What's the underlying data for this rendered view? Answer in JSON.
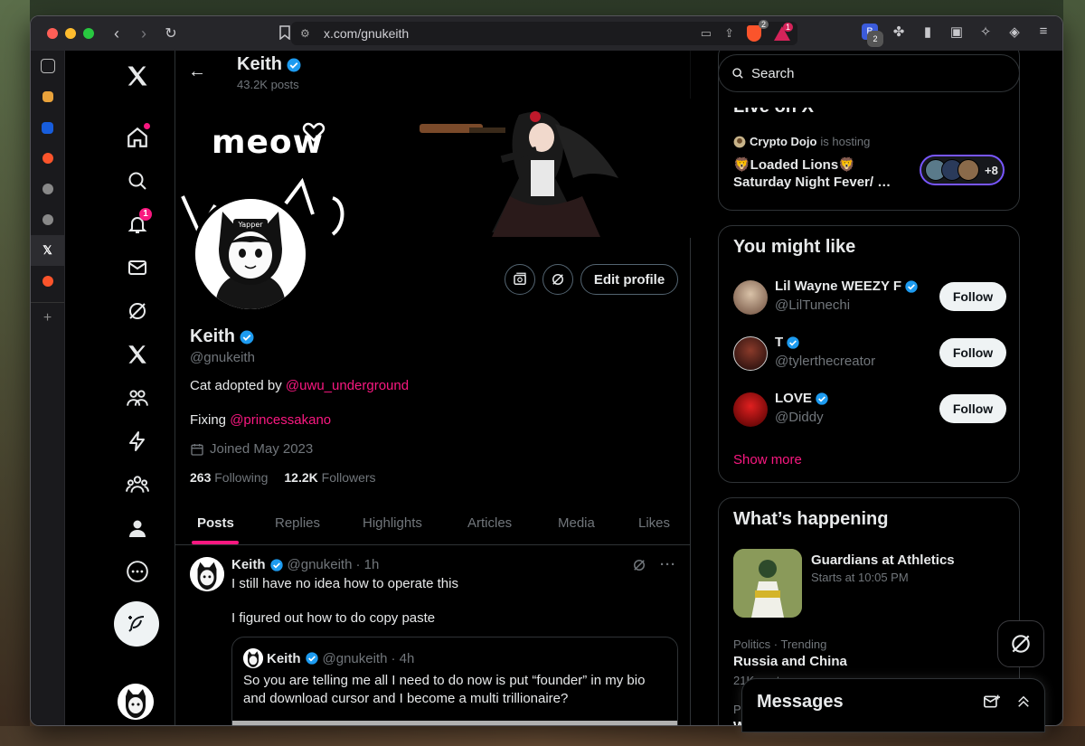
{
  "browser": {
    "url": "x.com/gnukeith",
    "brave_badge": "2",
    "rewards_badge": "1",
    "wallet_badge": "2"
  },
  "nav": {
    "notifications_badge": "1"
  },
  "header": {
    "name": "Keith",
    "posts": "43.2K posts"
  },
  "banner": {
    "meow_text": "meow",
    "yapper_text": "Yapper"
  },
  "profile": {
    "edit_label": "Edit profile",
    "name": "Keith",
    "handle": "@gnukeith",
    "bio_line1_prefix": "Cat adopted by ",
    "bio_line1_link": "@uwu_underground",
    "bio_line2_prefix": "Fixing ",
    "bio_line2_link": "@princessakano",
    "joined": "Joined May 2023",
    "following_count": "263",
    "following_label": "Following",
    "followers_count": "12.2K",
    "followers_label": "Followers"
  },
  "tabs": [
    "Posts",
    "Replies",
    "Highlights",
    "Articles",
    "Media",
    "Likes"
  ],
  "tweet": {
    "name": "Keith",
    "handle": "@gnukeith",
    "time": "· 1h",
    "text1": "I still have no idea how to operate this",
    "text2": "I figured out how to do copy paste",
    "quote": {
      "name": "Keith",
      "handle": "@gnukeith",
      "time": "· 4h",
      "text": "So you are telling me all I need to do now is put “founder” in my bio and download cursor and I become a multi trillionaire?"
    }
  },
  "right": {
    "search_placeholder": "Search",
    "live": {
      "title": "Live on X",
      "host": "Crypto Dojo",
      "host_suffix": "is hosting",
      "space_title": "🦁Loaded Lions🦁 Saturday Night Fever/ …",
      "more_count": "+8"
    },
    "who": {
      "title": "You might like",
      "follow_label": "Follow",
      "accounts": [
        {
          "name": "Lil Wayne WEEZY F",
          "handle": "@LilTunechi"
        },
        {
          "name": "T",
          "handle": "@tylerthecreator"
        },
        {
          "name": "LOVE",
          "handle": "@Diddy"
        }
      ],
      "show_more": "Show more"
    },
    "happening": {
      "title": "What’s happening",
      "event": "Guardians at Athletics",
      "event_time": "Starts at 10:05 PM",
      "trend_category": "Politics · Trending",
      "trend_name": "Russia and China",
      "trend_count": "21K posts",
      "cut_text": "Po",
      "cut_text2": "W"
    }
  },
  "messages": {
    "title": "Messages"
  },
  "colors": {
    "accent": "#f91880",
    "verified": "#1d9bf0",
    "background": "#000000",
    "text": "#e7e9ea",
    "muted": "#71767b"
  }
}
